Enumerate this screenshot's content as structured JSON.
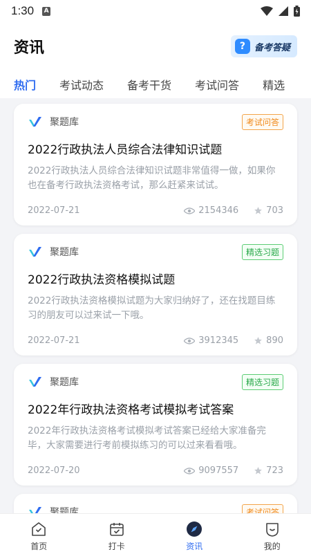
{
  "status": {
    "time": "1:30"
  },
  "header": {
    "title": "资讯",
    "badge_label": "备考答疑"
  },
  "tabs": [
    {
      "label": "热门",
      "active": true
    },
    {
      "label": "考试动态",
      "active": false
    },
    {
      "label": "备考干货",
      "active": false
    },
    {
      "label": "考试问答",
      "active": false
    },
    {
      "label": "精选",
      "active": false
    }
  ],
  "articles": [
    {
      "source": "聚题库",
      "tag": "考试问答",
      "tag_color": "orange",
      "title": "2022行政执法人员综合法律知识试题",
      "desc": "2022行政执法人员综合法律知识试题非常值得一做，如果你也在备考行政执法资格考试，那么赶紧来试试。",
      "date": "2022-07-21",
      "views": "2154346",
      "stars": "703"
    },
    {
      "source": "聚题库",
      "tag": "精选习题",
      "tag_color": "green",
      "title": "2022行政执法资格模拟试题",
      "desc": "2022行政执法资格模拟试题为大家归纳好了，还在找题目练习的朋友可以过来试一下哦。",
      "date": "2022-07-21",
      "views": "3912345",
      "stars": "890"
    },
    {
      "source": "聚题库",
      "tag": "精选习题",
      "tag_color": "green",
      "title": "2022年行政执法资格考试模拟考试答案",
      "desc": "2022年行政执法资格考试模拟考试答案已经给大家准备完毕，大家需要进行考前模拟练习的可以过来看看哦。",
      "date": "2022-07-20",
      "views": "9097557",
      "stars": "723"
    },
    {
      "source": "聚题库",
      "tag": "考试问答",
      "tag_color": "orange"
    }
  ],
  "nav": [
    {
      "label": "首页",
      "icon": "home-icon"
    },
    {
      "label": "打卡",
      "icon": "calendar-icon"
    },
    {
      "label": "资讯",
      "icon": "compass-icon",
      "active": true
    },
    {
      "label": "我的",
      "icon": "profile-icon"
    }
  ],
  "colors": {
    "accent": "#2f6cf0",
    "orange_tag": "#f08a1c",
    "green_tag": "#2aa84a"
  }
}
